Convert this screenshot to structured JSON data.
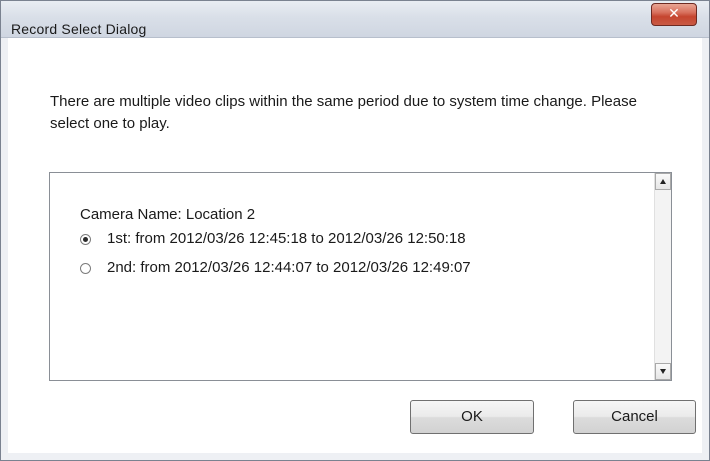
{
  "window": {
    "title": "Record Select Dialog",
    "close_glyph": "✕"
  },
  "message": "There are multiple video clips within the same period due to system time change. Please select one to play.",
  "list": {
    "camera_label": "Camera Name: Location 2",
    "options": [
      {
        "label": "1st: from 2012/03/26 12:45:18 to 2012/03/26 12:50:18",
        "selected": true
      },
      {
        "label": "2nd: from 2012/03/26 12:44:07 to 2012/03/26 12:49:07",
        "selected": false
      }
    ]
  },
  "buttons": {
    "ok": "OK",
    "cancel": "Cancel"
  },
  "icons": {
    "close": "close-icon",
    "scroll_up": "scroll-up-arrow-icon",
    "scroll_down": "scroll-down-arrow-icon"
  },
  "colors": {
    "close_button": "#c95a44",
    "dialog_background": "#ffffff",
    "titlebar": "#d9dfe8"
  }
}
